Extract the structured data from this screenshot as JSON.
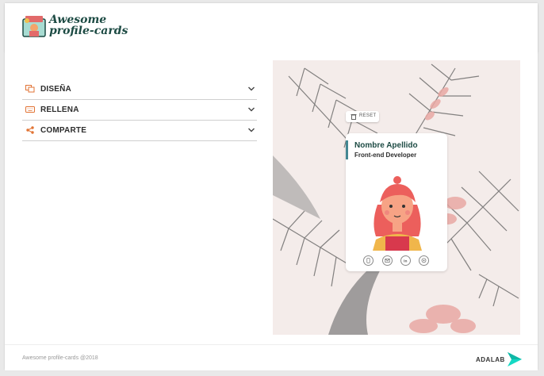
{
  "header": {
    "logo_line1": "Awesome",
    "logo_line2": "profile-cards"
  },
  "sections": [
    {
      "label": "DISEÑA",
      "icon": "palette-icon"
    },
    {
      "label": "RELLENA",
      "icon": "keyboard-icon"
    },
    {
      "label": "COMPARTE",
      "icon": "share-icon"
    }
  ],
  "preview": {
    "reset_label": "RESET",
    "card_name": "Nombre Apellido",
    "card_job": "Front-end Developer",
    "social_icons": [
      "phone-icon",
      "email-icon",
      "linkedin-icon",
      "github-icon"
    ]
  },
  "footer": {
    "copyright": "Awesome profile-cards @2018",
    "brand": "ADALAB"
  },
  "colors": {
    "accent_orange": "#e17334",
    "brand_green": "#1d4b44",
    "card_bar": "#438792",
    "adalab_green": "#14d9c4"
  }
}
